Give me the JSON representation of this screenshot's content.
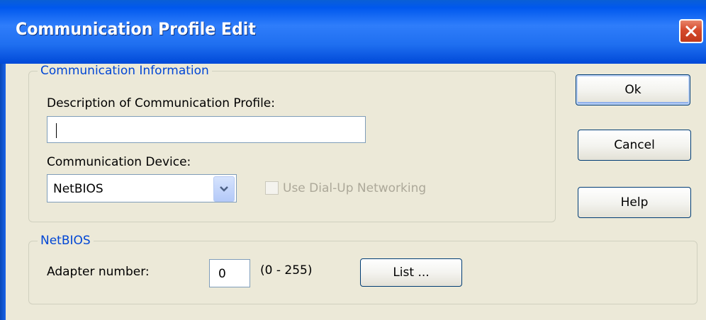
{
  "window": {
    "title": "Communication Profile Edit",
    "close_icon": "close-icon"
  },
  "communication_info": {
    "legend": "Communication Information",
    "description_label": "Description of Communication Profile:",
    "description_value": "",
    "device_label": "Communication Device:",
    "device_value": "NetBIOS",
    "dialup_label": "Use Dial-Up Networking",
    "dialup_checked": false
  },
  "netbios": {
    "legend": "NetBIOS",
    "adapter_label": "Adapter number:",
    "adapter_value": "0",
    "adapter_range": "(0 - 255)",
    "list_label": "List ..."
  },
  "buttons": {
    "ok": "Ok",
    "cancel": "Cancel",
    "help": "Help"
  },
  "colors": {
    "title_bar": "#1f6ff0",
    "group_legend": "#0046d5",
    "close": "#d54a2c"
  }
}
